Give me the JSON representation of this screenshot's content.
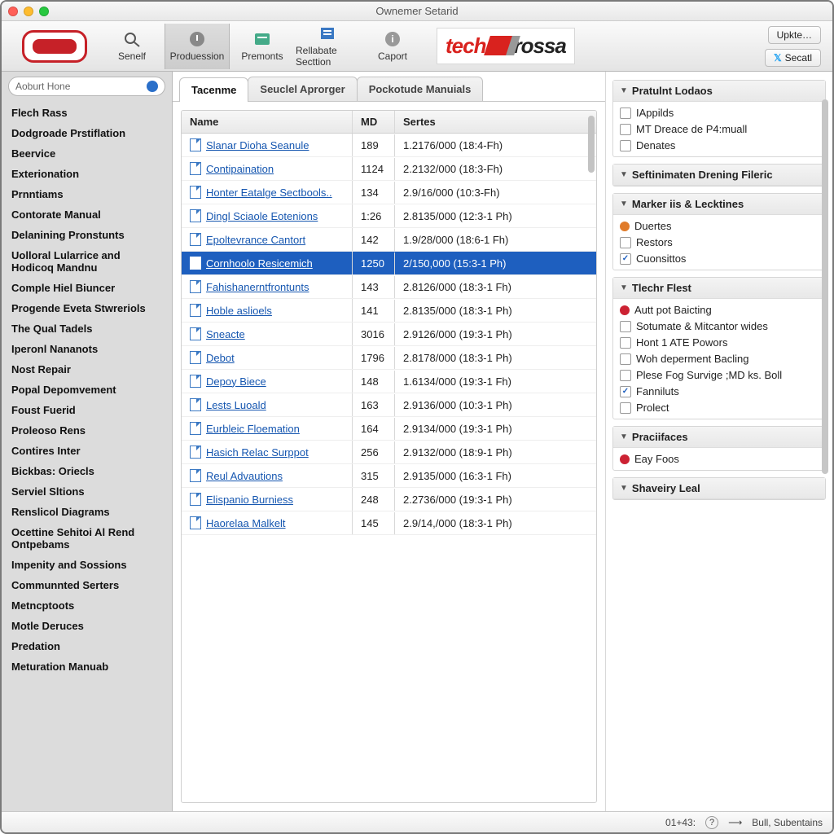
{
  "window": {
    "title": "Ownemer Setarid"
  },
  "toolbar": {
    "buttons": [
      {
        "key": "senelf",
        "label": "Senelf"
      },
      {
        "key": "prod",
        "label": "Produession"
      },
      {
        "key": "prem",
        "label": "Premonts"
      },
      {
        "key": "relab",
        "label": "Rellabate Secttion"
      },
      {
        "key": "caport",
        "label": "Caport"
      }
    ],
    "brand_part1": "tech",
    "brand_part2": "rossa",
    "update_label": "Upkte…",
    "social_label": "Secatl"
  },
  "sidebar": {
    "search_placeholder": "Aoburt Hone",
    "items": [
      "Flech Rass",
      "Dodgroade Prstiflation",
      "Beervice",
      "Exterionation",
      "Prnntiams",
      "Contorate Manual",
      "Delanining Pronstunts",
      "Uolloral Lularrice and Hodicoq Mandnu",
      "Comple Hiel Biuncer",
      "Progende Eveta Stwreriols",
      "The Qual Tadels",
      "Iperonl Nananots",
      "Nost Repair",
      "Popal Depomvement",
      "Foust Fuerid",
      "Proleoso Rens",
      "Contires Inter",
      "Bickbas: Oriecls",
      "Serviel Sltions",
      "Renslicol Diagrams",
      "Ocettine Sehitoi Al Rend Ontpebams",
      "Impenity and Sossions",
      "Communnted Serters",
      "Metncptoots",
      "Motle Deruces",
      "Predation",
      "Meturation Manuab"
    ]
  },
  "tabs": [
    {
      "label": "Tacenme",
      "active": true
    },
    {
      "label": "Seuclel Aprorger",
      "active": false
    },
    {
      "label": "Pockotude Manuials",
      "active": false
    }
  ],
  "table": {
    "headers": {
      "name": "Name",
      "md": "MD",
      "sertes": "Sertes"
    },
    "rows": [
      {
        "name": "Slanar Dioha Seanule",
        "md": "189",
        "ser": "1.2176/000 (18:4-Fh)"
      },
      {
        "name": "Contipaination",
        "md": "1124",
        "ser": "2.2132/000 (18:3-Fh)"
      },
      {
        "name": "Honter Eatalge Sectbools..",
        "md": "134",
        "ser": "2.9/16/000 (10:3-Fh)"
      },
      {
        "name": "Dingl Sciaole Eotenions",
        "md": "1:26",
        "ser": "2.8135/000 (12:3-1 Ph)"
      },
      {
        "name": "Epoltevrance Cantort",
        "md": "142",
        "ser": "1.9/28/000 (18:6-1 Fh)"
      },
      {
        "name": "Cornhoolo Resicemich",
        "md": "1250",
        "ser": "2/150,000 (15:3-1 Ph)",
        "selected": true
      },
      {
        "name": "Fahishanerntfrontunts",
        "md": "143",
        "ser": "2.8126/000 (18:3-1 Fh)"
      },
      {
        "name": "Hoble aslioels",
        "md": "141",
        "ser": "2.8135/000 (18:3-1 Ph)"
      },
      {
        "name": "Sneacte",
        "md": "3016",
        "ser": "2.9126/000 (19:3-1 Ph)"
      },
      {
        "name": "Debot",
        "md": "1796",
        "ser": "2.8178/000 (18:3-1 Ph)"
      },
      {
        "name": "Depoy Biece",
        "md": "148",
        "ser": "1.6134/000 (19:3-1 Fh)"
      },
      {
        "name": "Lests Luoald",
        "md": "163",
        "ser": "2.9136/000 (10:3-1 Ph)"
      },
      {
        "name": "Eurbleic Floemation",
        "md": "164",
        "ser": "2.9134/000 (19:3-1 Ph)"
      },
      {
        "name": "Hasich Relac Surppot",
        "md": "256",
        "ser": "2.9132/000 (18:9-1 Ph)"
      },
      {
        "name": "Reul Advautions",
        "md": "315",
        "ser": "2.9135/000 (16:3-1 Fh)"
      },
      {
        "name": "Elispanio Burniess",
        "md": "248",
        "ser": "2.2736/000 (19:3-1 Ph)"
      },
      {
        "name": "Haorelaa Malkelt",
        "md": "145",
        "ser": "2.9/14,/000 (18:3-1 Ph)"
      }
    ]
  },
  "right": {
    "sections": [
      {
        "title": "Pratulnt Lodaos",
        "items": [
          {
            "label": "IAppilds",
            "checked": false
          },
          {
            "label": "MT Dreace de P4:muall",
            "checked": false
          },
          {
            "label": "Denates",
            "checked": false
          }
        ]
      },
      {
        "title": "Seftinimaten Drening Fileric",
        "collapsed": true
      },
      {
        "title": "Marker iis & Lecktines",
        "items": [
          {
            "label": "Duertes",
            "bullet": "#e07b2a"
          },
          {
            "label": "Restors",
            "checked": false
          },
          {
            "label": "Cuonsittos",
            "checked": true
          }
        ]
      },
      {
        "title": "Tlechr Flest",
        "items": [
          {
            "label": "Autt pot Baicting",
            "bullet": "#c23"
          },
          {
            "label": "Sotumate & Mitcantor wides",
            "checked": false
          },
          {
            "label": "Hont 1 ATE Powors",
            "checked": false
          },
          {
            "label": "Woh deperment Bacling",
            "checked": false
          },
          {
            "label": "Plese Fog Survige ;MD ks. Boll",
            "checked": false
          },
          {
            "label": "Fanniluts",
            "checked": true
          },
          {
            "label": "Prolect",
            "checked": false
          }
        ]
      },
      {
        "title": "Praciifaces",
        "items": [
          {
            "label": "Eay Foos",
            "bullet": "#c23"
          }
        ]
      },
      {
        "title": "Shaveiry Leal",
        "collapsed": true
      }
    ]
  },
  "status": {
    "left": "01+43:",
    "right": "Bull, Subentains"
  }
}
